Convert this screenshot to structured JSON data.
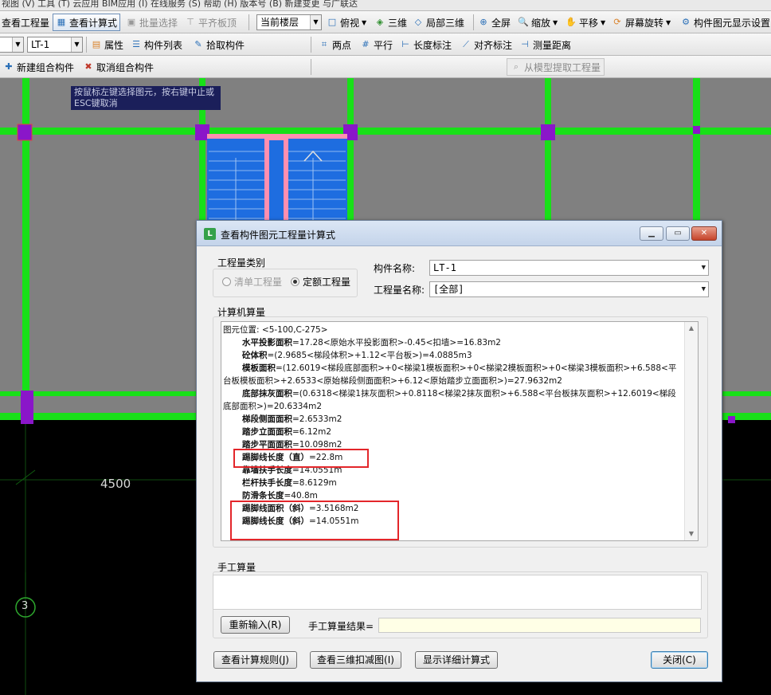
{
  "toolbar_row0": {
    "text": "视图 (V)    工具 (T)    云应用    BIM应用 (I)    在线服务 (S)    帮助 (H)    版本号 (B)    新建变更    与广联达"
  },
  "toolbar_row1": {
    "view_quantity": "查看工程量",
    "view_formula": "查看计算式",
    "batch_select": "批量选择",
    "align_slab_top": "平齐板顶",
    "current_floor": "当前楼层",
    "top_view": "俯视",
    "three_d": "三维",
    "partial_3d": "局部三维",
    "fullscreen": "全屏",
    "zoom": "缩放",
    "pan": "平移",
    "screen_rotate": "屏幕旋转",
    "display_settings": "构件图元显示设置"
  },
  "toolbar_row2": {
    "component_value": "LT-1",
    "properties": "属性",
    "component_list": "构件列表",
    "pick_component": "拾取构件",
    "two_points": "两点",
    "parallel": "平行",
    "length_annotation": "长度标注",
    "aligned_annotation": "对齐标注",
    "measure_distance": "测量距离"
  },
  "toolbar_row3": {
    "new_group": "新建组合构件",
    "cancel_group": "取消组合构件",
    "extract_from_model": "从模型提取工程量"
  },
  "canvas": {
    "tooltip": "按鼠标左键选择图元，按右键中止或ESC键取消",
    "dimension_4500": "4500",
    "axis_3": "3"
  },
  "dialog": {
    "title": "查看构件图元工程量计算式",
    "quantity_type_label": "工程量类别",
    "radio_bill": "清单工程量",
    "radio_quota": "定额工程量",
    "component_name_label": "构件名称:",
    "component_name_value": "LT-1",
    "quantity_name_label": "工程量名称:",
    "quantity_name_value": "[全部]",
    "computer_calc_label": "计算机算量",
    "lines": [
      {
        "label": "图元位置:",
        "value": "<5-100,C-275>"
      },
      {
        "label": "水平投影面积",
        "value": "=17.28<原始水平投影面积>-0.45<扣墙>=16.83m2"
      },
      {
        "label": "砼体积",
        "value": "=(2.9685<梯段体积>+1.12<平台板>)=4.0885m3"
      },
      {
        "label": "模板面积",
        "value": "=(12.6019<梯段底部面积>+0<梯梁1模板面积>+0<梯梁2模板面积>+0<梯梁3模板面积>+6.588<平台板模板面积>+2.6533<原始梯段侧面面积>+6.12<原始踏步立面面积>)=27.9632m2"
      },
      {
        "label": "底部抹灰面积",
        "value": "=(0.6318<梯梁1抹灰面积>+0.8118<梯梁2抹灰面积>+6.588<平台板抹灰面积>+12.6019<梯段底部面积>)=20.6334m2"
      },
      {
        "label": "梯段侧面面积",
        "value": "=2.6533m2"
      },
      {
        "label": "踏步立面面积",
        "value": "=6.12m2"
      },
      {
        "label": "踏步平面面积",
        "value": "=10.098m2"
      },
      {
        "label": "踢脚线长度（直）",
        "value": "=22.8m"
      },
      {
        "label": "靠墙扶手长度",
        "value": "=14.0551m"
      },
      {
        "label": "栏杆扶手长度",
        "value": "=8.6129m"
      },
      {
        "label": "防滑条长度",
        "value": "=40.8m"
      },
      {
        "label": "踢脚线面积（斜）",
        "value": "=3.5168m2"
      },
      {
        "label": "踢脚线长度（斜）",
        "value": "=14.0551m"
      }
    ],
    "manual_calc_label": "手工算量",
    "reenter_button": "重新输入(R)",
    "manual_result_label": "手工算量结果=",
    "view_rules_button": "查看计算规则(J)",
    "view_3d_button": "查看三维扣减图(I)",
    "show_detail_button": "显示详细计算式",
    "close_button": "关闭(C)"
  }
}
